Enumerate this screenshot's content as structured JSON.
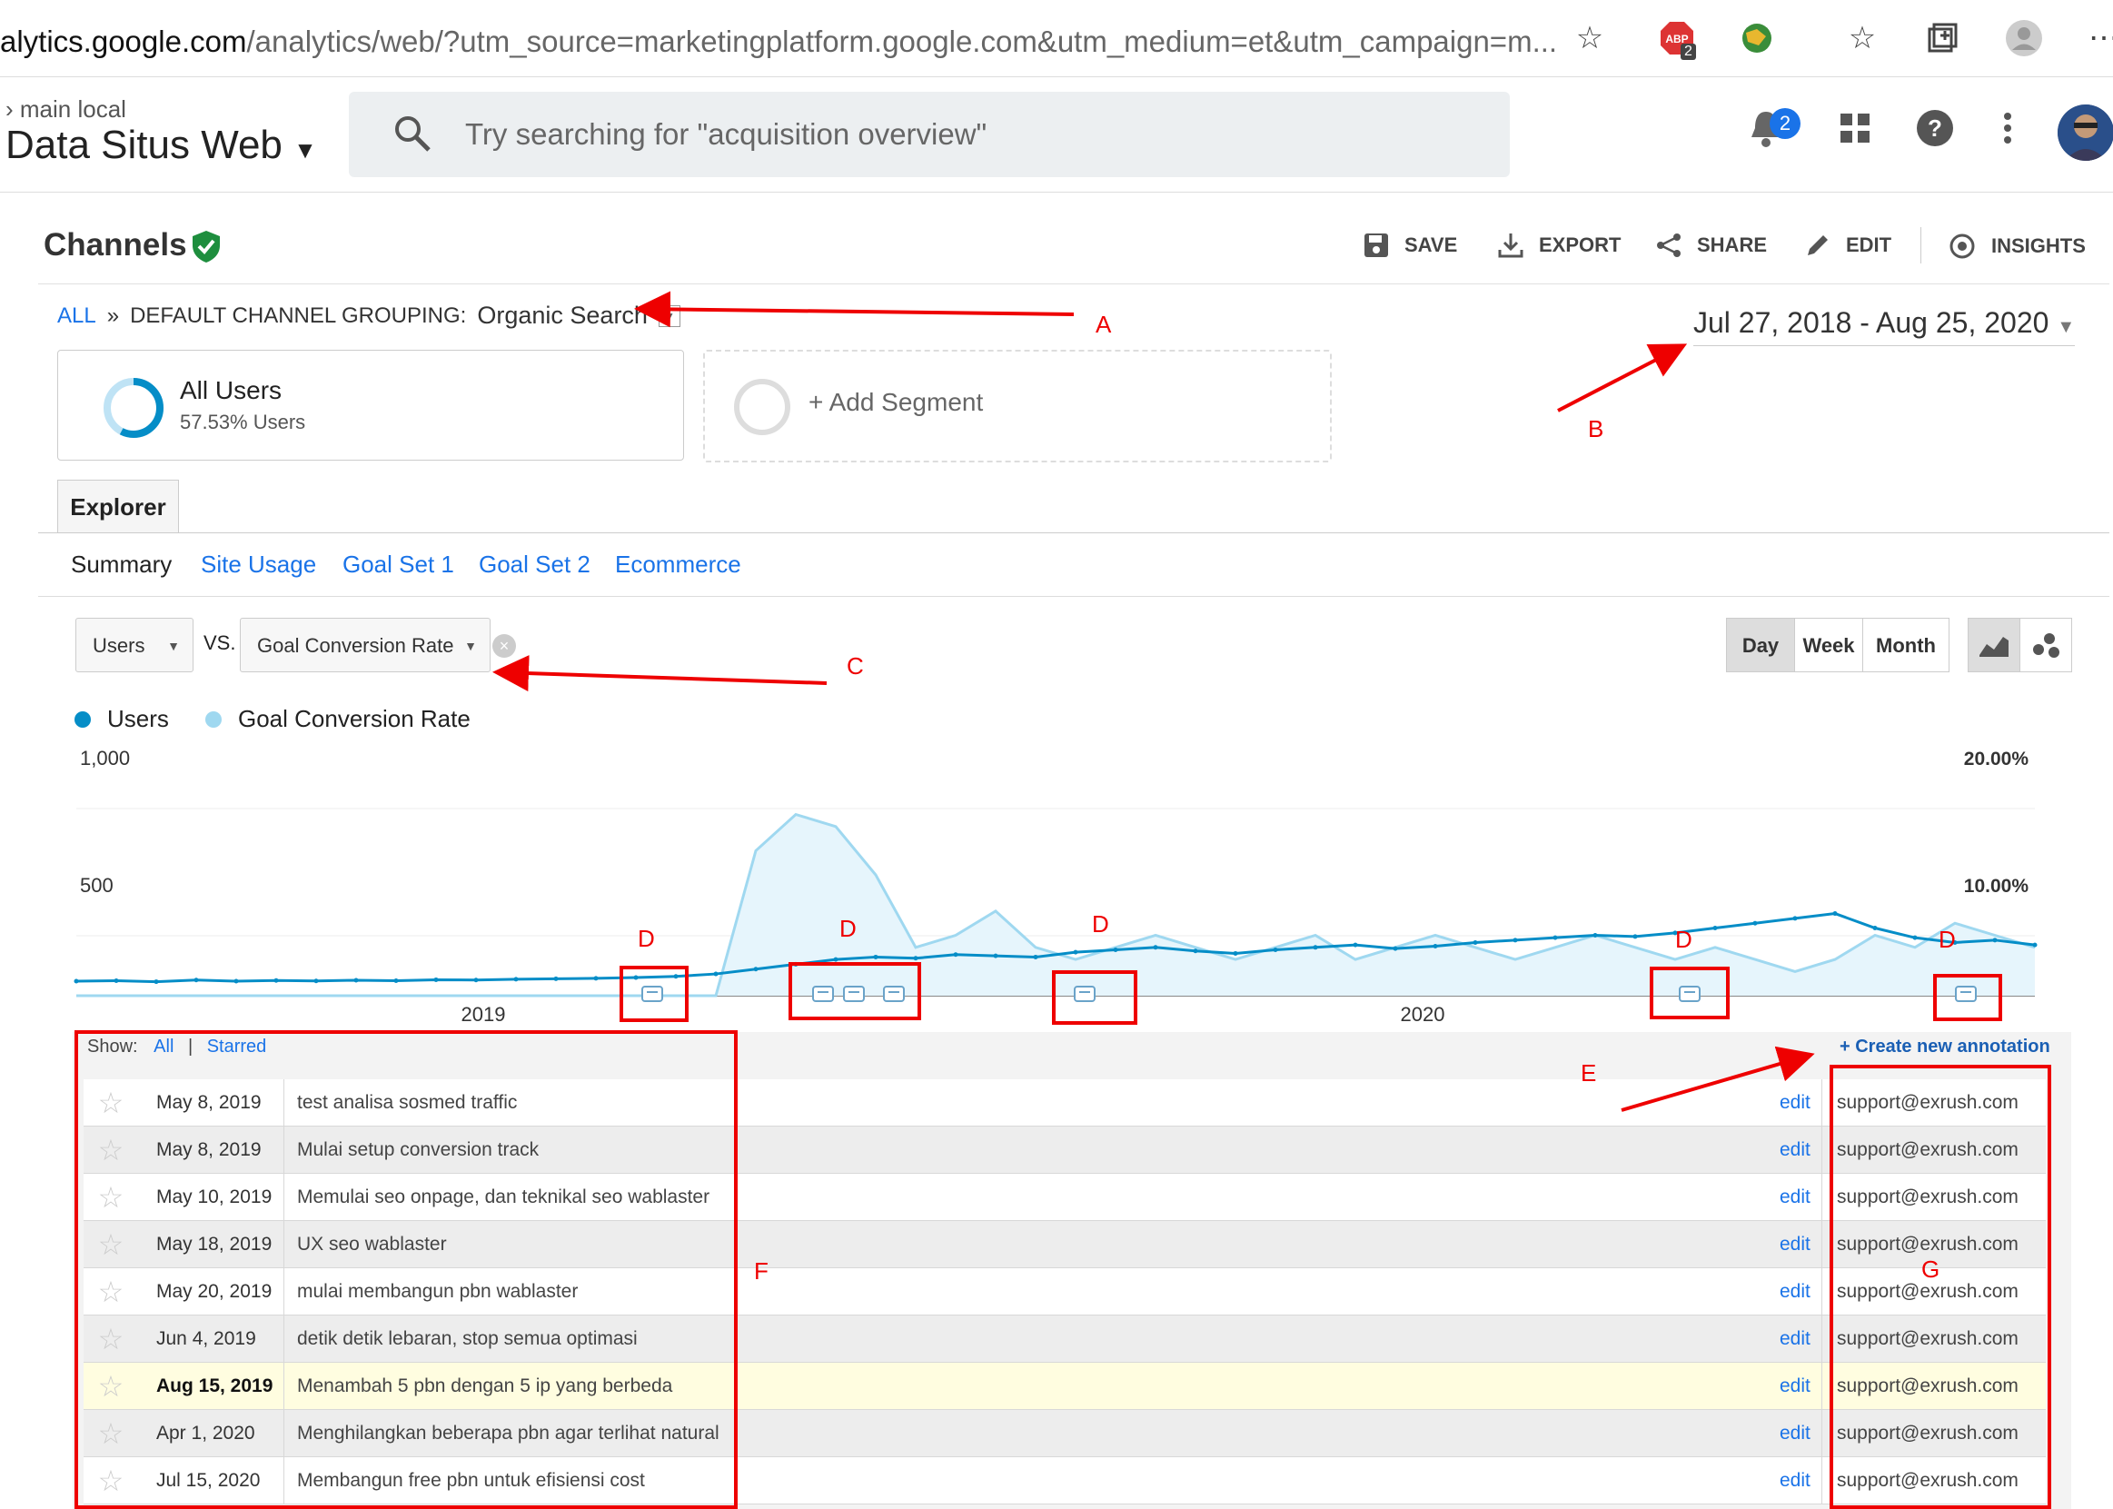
{
  "browser": {
    "url_host": "alytics.google.com",
    "url_rest": "/analytics/web/?utm_source=marketingplatform.google.com&utm_medium=et&utm_campaign=m...",
    "ext_badge": "2"
  },
  "header": {
    "breadcrumb": "main local",
    "property": "Data Situs Web",
    "search_placeholder": "Try searching for \"acquisition overview\"",
    "notifications_count": "2"
  },
  "report": {
    "title": "Channels",
    "actions": {
      "save": "SAVE",
      "export": "EXPORT",
      "share": "SHARE",
      "edit": "EDIT",
      "insights": "INSIGHTS"
    },
    "grouping": {
      "all": "ALL",
      "sep": "»",
      "label": "DEFAULT CHANNEL GROUPING:",
      "value": "Organic Search"
    },
    "date_range": "Jul 27, 2018 - Aug 25, 2020"
  },
  "segments": {
    "all_users_title": "All Users",
    "all_users_pct": "57.53% Users",
    "all_users_ring_fraction": 0.5753,
    "add_segment": "+ Add Segment"
  },
  "tabs": {
    "explorer": "Explorer",
    "subtabs": [
      "Summary",
      "Site Usage",
      "Goal Set 1",
      "Goal Set 2",
      "Ecommerce"
    ]
  },
  "controls": {
    "metric1": "Users",
    "vs": "VS.",
    "metric2": "Goal Conversion Rate",
    "granularity": [
      "Day",
      "Week",
      "Month"
    ],
    "selected_granularity": "Day"
  },
  "legend": {
    "users": "Users",
    "goal": "Goal Conversion Rate",
    "users_color": "#058dc7",
    "goal_color": "#9fd8f0"
  },
  "chart_data": {
    "type": "line",
    "x_ticks": [
      "2019",
      "2020"
    ],
    "y_left_ticks": [
      "1,000",
      "500"
    ],
    "y_right_ticks": [
      "20.00%",
      "10.00%"
    ],
    "ylim_left": [
      0,
      1000
    ],
    "ylim_right": [
      0,
      20
    ],
    "series": [
      {
        "name": "Users",
        "values": [
          60,
          62,
          58,
          65,
          60,
          63,
          61,
          64,
          62,
          66,
          65,
          68,
          70,
          72,
          75,
          80,
          90,
          110,
          130,
          150,
          160,
          155,
          170,
          165,
          160,
          180,
          190,
          200,
          185,
          175,
          190,
          200,
          210,
          195,
          205,
          220,
          230,
          240,
          250,
          245,
          260,
          280,
          300,
          320,
          340,
          280,
          240,
          220,
          230,
          210
        ]
      },
      {
        "name": "Goal Conversion Rate",
        "values": [
          0,
          0,
          0,
          0,
          0,
          0,
          0,
          0,
          0,
          0,
          0,
          0,
          0,
          0,
          0,
          0,
          0,
          12,
          15,
          14,
          10,
          4,
          5,
          7,
          4,
          3,
          4,
          5,
          4,
          3,
          4,
          5,
          3,
          4,
          5,
          4,
          3,
          4,
          5,
          4,
          3,
          4,
          3,
          2,
          3,
          5,
          4,
          6,
          5,
          4
        ]
      }
    ]
  },
  "annotations": {
    "show_label": "Show:",
    "show_all": "All",
    "show_sep": "|",
    "show_starred": "Starred",
    "create": "+ Create new annotation",
    "edit_label": "edit",
    "rows": [
      {
        "date": "May 8, 2019",
        "note": "test analisa sosmed traffic",
        "email": "support@exrush.com"
      },
      {
        "date": "May 8, 2019",
        "note": "Mulai setup conversion track",
        "email": "support@exrush.com"
      },
      {
        "date": "May 10, 2019",
        "note": "Memulai seo onpage, dan teknikal seo wablaster",
        "email": "support@exrush.com"
      },
      {
        "date": "May 18, 2019",
        "note": "UX seo wablaster",
        "email": "support@exrush.com"
      },
      {
        "date": "May 20, 2019",
        "note": "mulai membangun pbn wablaster",
        "email": "support@exrush.com"
      },
      {
        "date": "Jun 4, 2019",
        "note": "detik detik lebaran, stop semua optimasi",
        "email": "support@exrush.com"
      },
      {
        "date": "Aug 15, 2019",
        "note": "Menambah 5 pbn dengan 5 ip yang berbeda",
        "email": "support@exrush.com"
      },
      {
        "date": "Apr 1, 2020",
        "note": "Menghilangkan beberapa pbn agar terlihat natural",
        "email": "support@exrush.com"
      },
      {
        "date": "Jul 15, 2020",
        "note": "Membangun free pbn untuk efisiensi cost",
        "email": "support@exrush.com"
      }
    ]
  },
  "markup_labels": {
    "a": "A",
    "b": "B",
    "c": "C",
    "d": "D",
    "e": "E",
    "f": "F",
    "g": "G"
  }
}
